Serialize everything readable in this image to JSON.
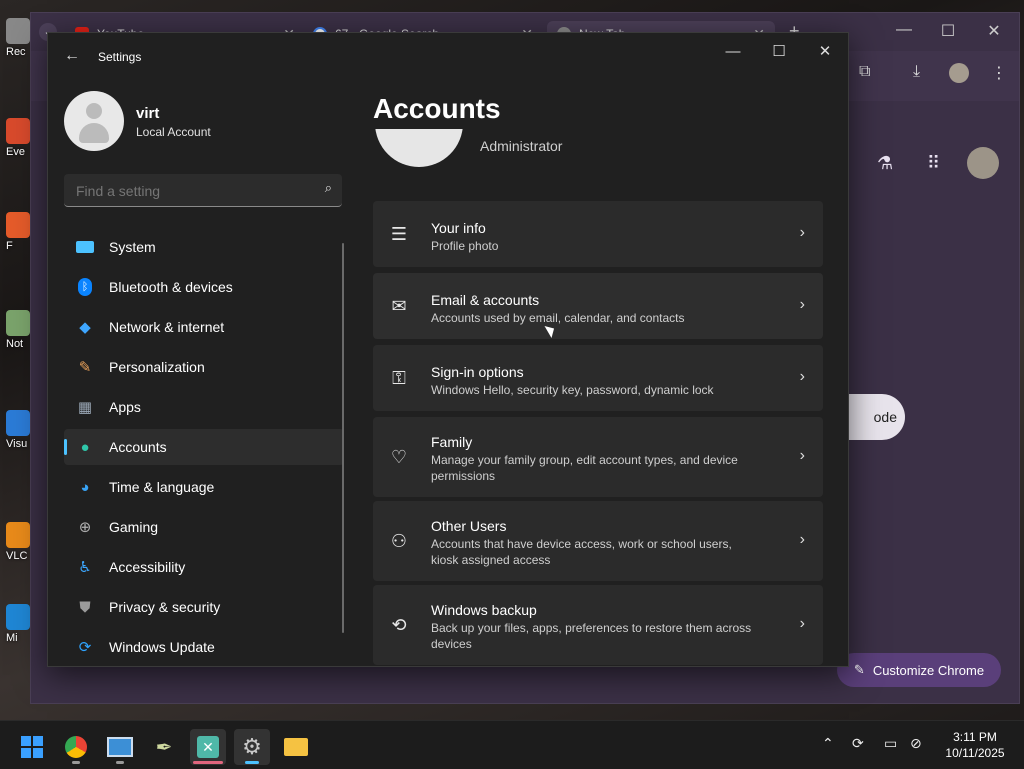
{
  "desktop": {
    "icons": [
      {
        "label": "Rec"
      },
      {
        "label": "Eve"
      },
      {
        "label": "F"
      },
      {
        "label": "Not"
      },
      {
        "label": "Visu"
      },
      {
        "label": "VLC"
      },
      {
        "label": "Mi"
      }
    ]
  },
  "chrome": {
    "tabs": [
      {
        "title": "YouTube",
        "close": "✕"
      },
      {
        "title": "67 - Google Search",
        "close": "✕"
      },
      {
        "title": "New Tab",
        "close": "✕"
      }
    ],
    "new_tab": "+",
    "mode_pill": "ode",
    "customize": "Customize Chrome"
  },
  "settings": {
    "app_title": "Settings",
    "user": {
      "name": "virt",
      "account_type": "Local Account"
    },
    "search": {
      "placeholder": "Find a setting"
    },
    "nav": [
      {
        "label": "System",
        "icon": "system-icon",
        "color": "#4cc2ff"
      },
      {
        "label": "Bluetooth & devices",
        "icon": "bluetooth-icon",
        "color": "#0a84ff"
      },
      {
        "label": "Network & internet",
        "icon": "wifi-icon",
        "color": "#3ea6ff"
      },
      {
        "label": "Personalization",
        "icon": "brush-icon",
        "color": "#e8a15a"
      },
      {
        "label": "Apps",
        "icon": "apps-icon",
        "color": "#9aa7b6"
      },
      {
        "label": "Accounts",
        "icon": "accounts-icon",
        "color": "#2fc6a9"
      },
      {
        "label": "Time & language",
        "icon": "globe-icon",
        "color": "#38a3f5"
      },
      {
        "label": "Gaming",
        "icon": "gaming-icon",
        "color": "#b0b0b0"
      },
      {
        "label": "Accessibility",
        "icon": "accessibility-icon",
        "color": "#3ca7ff"
      },
      {
        "label": "Privacy & security",
        "icon": "shield-icon",
        "color": "#9b9b9b"
      },
      {
        "label": "Windows Update",
        "icon": "update-icon",
        "color": "#2fa4ff"
      }
    ],
    "active_nav": "Accounts",
    "page_title": "Accounts",
    "profile_role": "Administrator",
    "cards": [
      {
        "title": "Your info",
        "subtitle": "Profile photo",
        "icon": "person-list-icon"
      },
      {
        "title": "Email & accounts",
        "subtitle": "Accounts used by email, calendar, and contacts",
        "icon": "mail-icon"
      },
      {
        "title": "Sign-in options",
        "subtitle": "Windows Hello, security key, password, dynamic lock",
        "icon": "key-icon"
      },
      {
        "title": "Family",
        "subtitle": "Manage your family group, edit account types, and device permissions",
        "icon": "family-heart-icon"
      },
      {
        "title": "Other Users",
        "subtitle": "Accounts that have device access, work or school users, kiosk assigned access",
        "icon": "add-user-icon"
      },
      {
        "title": "Windows backup",
        "subtitle": "Back up your files, apps, preferences to restore them across devices",
        "icon": "backup-icon"
      }
    ]
  },
  "taskbar": {
    "clock": {
      "time": "3:11 PM",
      "date": "10/11/2025"
    }
  }
}
